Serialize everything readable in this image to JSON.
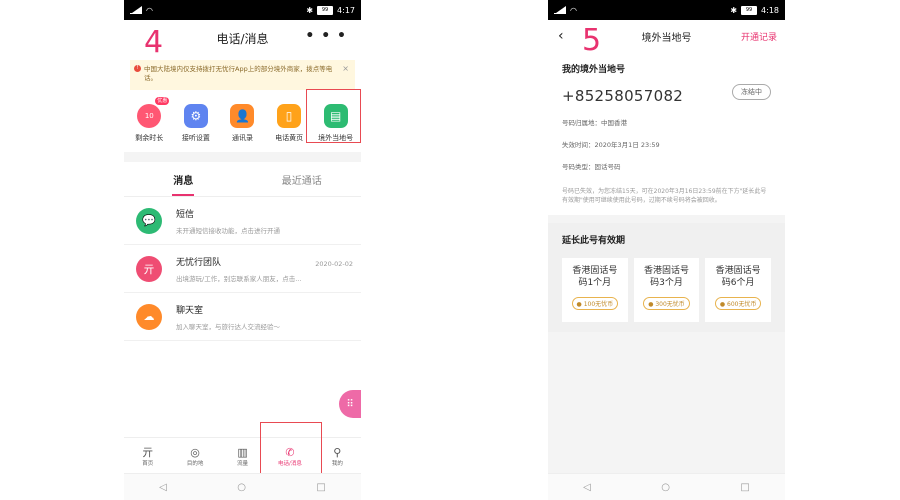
{
  "steps": {
    "left": "4",
    "right": "5"
  },
  "left": {
    "status": {
      "icons_left": "📶",
      "time": "4:17",
      "battery": "99"
    },
    "title": "电话/消息",
    "more": "• • •",
    "notice": "中国大陆境内仅支持拨打无忧行App上的部分境外商家，拨点等电话。",
    "tools": [
      {
        "label": "剩余时长",
        "icon": "clock-icon",
        "badge": "优惠",
        "color": "#ff5773",
        "glyph": "10"
      },
      {
        "label": "接听设置",
        "icon": "settings-icon",
        "color": "#5f84f0",
        "glyph": "⚙"
      },
      {
        "label": "通讯录",
        "icon": "contacts-icon",
        "color": "#ff8a2a",
        "glyph": "👤"
      },
      {
        "label": "电话黄页",
        "icon": "yellowpage-icon",
        "color": "#ffa21a",
        "glyph": "▯"
      },
      {
        "label": "境外当地号",
        "icon": "local-number-icon",
        "color": "#2dbb72",
        "glyph": "▤"
      }
    ],
    "tabs": [
      "消息",
      "最近通话"
    ],
    "messages": [
      {
        "title": "短信",
        "sub": "未开通短信接收功能，点击进行开通",
        "date": "",
        "color": "#2dba74",
        "glyph": "💬"
      },
      {
        "title": "无忧行团队",
        "sub": "出境游玩/工作，别忘联系家人朋友，点击...",
        "date": "2020-02-02",
        "color": "#ef4d73",
        "glyph": "亓"
      },
      {
        "title": "聊天室",
        "sub": "加入聊天室，与旅行达人交流经验～",
        "date": "",
        "color": "#ff8a2a",
        "glyph": "☁"
      }
    ],
    "bottom_nav": [
      {
        "label": "首页",
        "glyph": "亓"
      },
      {
        "label": "目的地",
        "glyph": "◎"
      },
      {
        "label": "流量",
        "glyph": "▥"
      },
      {
        "label": "电话/消息",
        "glyph": "✆"
      },
      {
        "label": "我的",
        "glyph": "⚲"
      }
    ],
    "sysnav": [
      "◁",
      "○",
      "□"
    ]
  },
  "right": {
    "status": {
      "icons_left": "📶",
      "time": "4:18",
      "battery": "99"
    },
    "back": "‹",
    "title": "境外当地号",
    "record": "开通记录",
    "card_title": "我的境外当地号",
    "number": "+85258057082",
    "frozen": "冻结中",
    "info": [
      "号码归属地：中国香港",
      "失效时间：2020年3月1日 23:59",
      "号码类型：固话号码"
    ],
    "note": "号码已失效，为您冻结15天，可在2020年3月16日23:59前在下方\"延长此号有效期\"使用可继续使用此号码，过期不续号码将会被回收。",
    "extend_title": "延长此号有效期",
    "options": [
      {
        "name": "香港固话号码1个月",
        "price": "100无忧币"
      },
      {
        "name": "香港固话号码3个月",
        "price": "300无忧币"
      },
      {
        "name": "香港固话号码6个月",
        "price": "600无忧币"
      }
    ],
    "sysnav": [
      "◁",
      "○",
      "□"
    ]
  }
}
